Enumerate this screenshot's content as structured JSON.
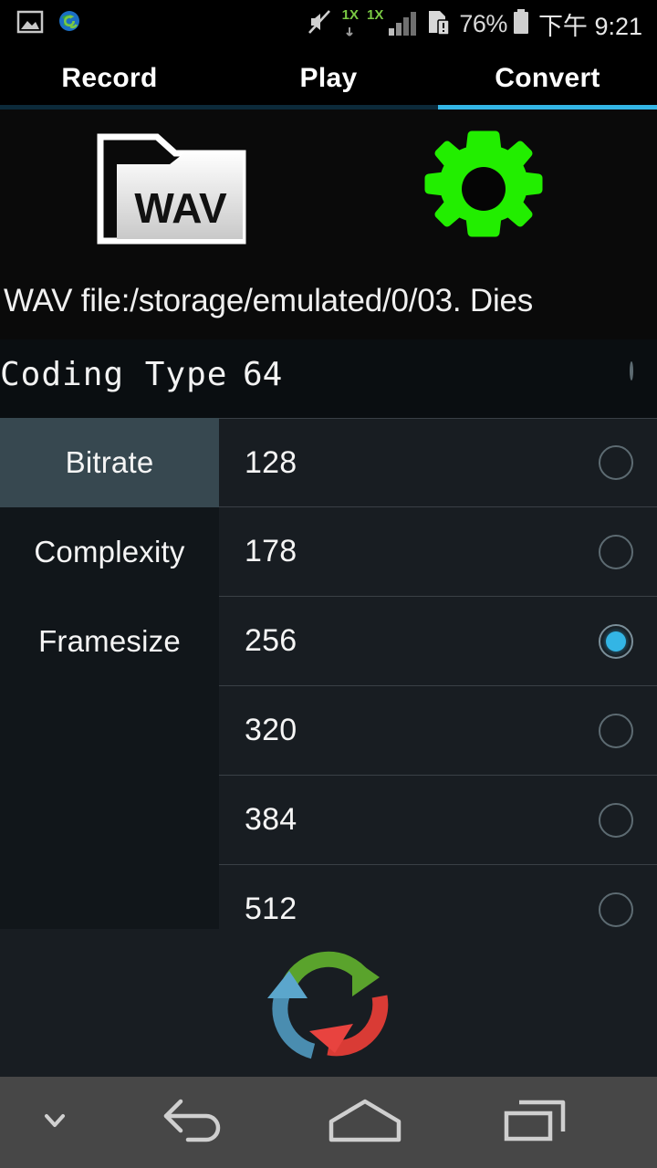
{
  "status_bar": {
    "left_icons": [
      {
        "name": "gallery-icon",
        "label": "gallery"
      },
      {
        "name": "globe-sync-icon",
        "label": "browser-sync"
      }
    ],
    "right_icons": [
      {
        "name": "mute-icon",
        "label": "sound off"
      },
      {
        "name": "network-1x-icon",
        "label": "1X"
      },
      {
        "name": "network-1x-signal-icon",
        "label": "1X"
      },
      {
        "name": "sd-card-icon",
        "label": "sd card"
      }
    ],
    "network_label_1": "1X",
    "network_label_2": "1X",
    "battery_percent": "76%",
    "time": "下午 9:21"
  },
  "tabs": [
    {
      "label": "Record",
      "active": false
    },
    {
      "label": "Play",
      "active": false
    },
    {
      "label": "Convert",
      "active": true
    }
  ],
  "header": {
    "folder_icon_label": "WAV",
    "folder_icon_name": "wav-folder-icon",
    "settings_icon_name": "gear-icon",
    "settings_icon_color": "#22ee00"
  },
  "file_info": {
    "path_text": "WAV file:/storage/emulated/0/03. Dies"
  },
  "coding_type": {
    "label": "Coding Type",
    "first_value": "64",
    "selected": false
  },
  "categories": [
    {
      "label": "Bitrate",
      "selected": true
    },
    {
      "label": "Complexity",
      "selected": false
    },
    {
      "label": "Framesize",
      "selected": false
    }
  ],
  "options": [
    {
      "value": "128",
      "selected": false
    },
    {
      "value": "178",
      "selected": false
    },
    {
      "value": "256",
      "selected": true
    },
    {
      "value": "320",
      "selected": false
    },
    {
      "value": "384",
      "selected": false
    },
    {
      "value": "512",
      "selected": false
    }
  ],
  "convert_action": {
    "icon_name": "convert-circular-arrows-icon",
    "colors": {
      "green": "#5aa32c",
      "red": "#e8433f",
      "blue": "#4a8db0"
    }
  },
  "nav_bar": {
    "buttons": [
      {
        "name": "hide-navbar-button",
        "icon": "chevron-down-icon"
      },
      {
        "name": "back-button",
        "icon": "back-arrow-icon"
      },
      {
        "name": "home-button",
        "icon": "home-icon"
      },
      {
        "name": "recents-button",
        "icon": "recents-icon"
      }
    ]
  },
  "theme": {
    "accent": "#33b5e5",
    "selected_category_bg": "#374850",
    "list_bg": "#181d22",
    "background": "#0a0a0a"
  }
}
